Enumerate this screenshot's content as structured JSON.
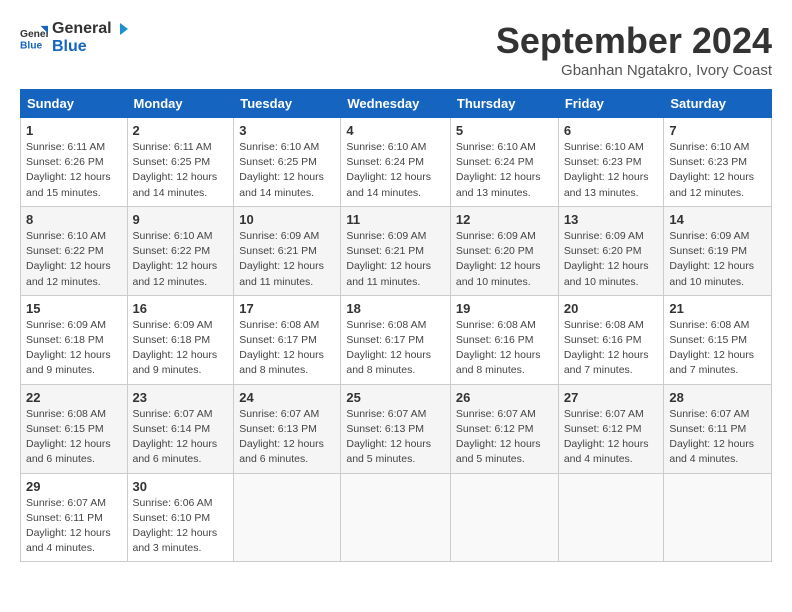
{
  "header": {
    "logo_general": "General",
    "logo_blue": "Blue",
    "month_title": "September 2024",
    "location": "Gbanhan Ngatakro, Ivory Coast"
  },
  "weekdays": [
    "Sunday",
    "Monday",
    "Tuesday",
    "Wednesday",
    "Thursday",
    "Friday",
    "Saturday"
  ],
  "weeks": [
    [
      {
        "day": "1",
        "info": "Sunrise: 6:11 AM\nSunset: 6:26 PM\nDaylight: 12 hours\nand 15 minutes."
      },
      {
        "day": "2",
        "info": "Sunrise: 6:11 AM\nSunset: 6:25 PM\nDaylight: 12 hours\nand 14 minutes."
      },
      {
        "day": "3",
        "info": "Sunrise: 6:10 AM\nSunset: 6:25 PM\nDaylight: 12 hours\nand 14 minutes."
      },
      {
        "day": "4",
        "info": "Sunrise: 6:10 AM\nSunset: 6:24 PM\nDaylight: 12 hours\nand 14 minutes."
      },
      {
        "day": "5",
        "info": "Sunrise: 6:10 AM\nSunset: 6:24 PM\nDaylight: 12 hours\nand 13 minutes."
      },
      {
        "day": "6",
        "info": "Sunrise: 6:10 AM\nSunset: 6:23 PM\nDaylight: 12 hours\nand 13 minutes."
      },
      {
        "day": "7",
        "info": "Sunrise: 6:10 AM\nSunset: 6:23 PM\nDaylight: 12 hours\nand 12 minutes."
      }
    ],
    [
      {
        "day": "8",
        "info": "Sunrise: 6:10 AM\nSunset: 6:22 PM\nDaylight: 12 hours\nand 12 minutes."
      },
      {
        "day": "9",
        "info": "Sunrise: 6:10 AM\nSunset: 6:22 PM\nDaylight: 12 hours\nand 12 minutes."
      },
      {
        "day": "10",
        "info": "Sunrise: 6:09 AM\nSunset: 6:21 PM\nDaylight: 12 hours\nand 11 minutes."
      },
      {
        "day": "11",
        "info": "Sunrise: 6:09 AM\nSunset: 6:21 PM\nDaylight: 12 hours\nand 11 minutes."
      },
      {
        "day": "12",
        "info": "Sunrise: 6:09 AM\nSunset: 6:20 PM\nDaylight: 12 hours\nand 10 minutes."
      },
      {
        "day": "13",
        "info": "Sunrise: 6:09 AM\nSunset: 6:20 PM\nDaylight: 12 hours\nand 10 minutes."
      },
      {
        "day": "14",
        "info": "Sunrise: 6:09 AM\nSunset: 6:19 PM\nDaylight: 12 hours\nand 10 minutes."
      }
    ],
    [
      {
        "day": "15",
        "info": "Sunrise: 6:09 AM\nSunset: 6:18 PM\nDaylight: 12 hours\nand 9 minutes."
      },
      {
        "day": "16",
        "info": "Sunrise: 6:09 AM\nSunset: 6:18 PM\nDaylight: 12 hours\nand 9 minutes."
      },
      {
        "day": "17",
        "info": "Sunrise: 6:08 AM\nSunset: 6:17 PM\nDaylight: 12 hours\nand 8 minutes."
      },
      {
        "day": "18",
        "info": "Sunrise: 6:08 AM\nSunset: 6:17 PM\nDaylight: 12 hours\nand 8 minutes."
      },
      {
        "day": "19",
        "info": "Sunrise: 6:08 AM\nSunset: 6:16 PM\nDaylight: 12 hours\nand 8 minutes."
      },
      {
        "day": "20",
        "info": "Sunrise: 6:08 AM\nSunset: 6:16 PM\nDaylight: 12 hours\nand 7 minutes."
      },
      {
        "day": "21",
        "info": "Sunrise: 6:08 AM\nSunset: 6:15 PM\nDaylight: 12 hours\nand 7 minutes."
      }
    ],
    [
      {
        "day": "22",
        "info": "Sunrise: 6:08 AM\nSunset: 6:15 PM\nDaylight: 12 hours\nand 6 minutes."
      },
      {
        "day": "23",
        "info": "Sunrise: 6:07 AM\nSunset: 6:14 PM\nDaylight: 12 hours\nand 6 minutes."
      },
      {
        "day": "24",
        "info": "Sunrise: 6:07 AM\nSunset: 6:13 PM\nDaylight: 12 hours\nand 6 minutes."
      },
      {
        "day": "25",
        "info": "Sunrise: 6:07 AM\nSunset: 6:13 PM\nDaylight: 12 hours\nand 5 minutes."
      },
      {
        "day": "26",
        "info": "Sunrise: 6:07 AM\nSunset: 6:12 PM\nDaylight: 12 hours\nand 5 minutes."
      },
      {
        "day": "27",
        "info": "Sunrise: 6:07 AM\nSunset: 6:12 PM\nDaylight: 12 hours\nand 4 minutes."
      },
      {
        "day": "28",
        "info": "Sunrise: 6:07 AM\nSunset: 6:11 PM\nDaylight: 12 hours\nand 4 minutes."
      }
    ],
    [
      {
        "day": "29",
        "info": "Sunrise: 6:07 AM\nSunset: 6:11 PM\nDaylight: 12 hours\nand 4 minutes."
      },
      {
        "day": "30",
        "info": "Sunrise: 6:06 AM\nSunset: 6:10 PM\nDaylight: 12 hours\nand 3 minutes."
      },
      {
        "day": "",
        "info": ""
      },
      {
        "day": "",
        "info": ""
      },
      {
        "day": "",
        "info": ""
      },
      {
        "day": "",
        "info": ""
      },
      {
        "day": "",
        "info": ""
      }
    ]
  ]
}
